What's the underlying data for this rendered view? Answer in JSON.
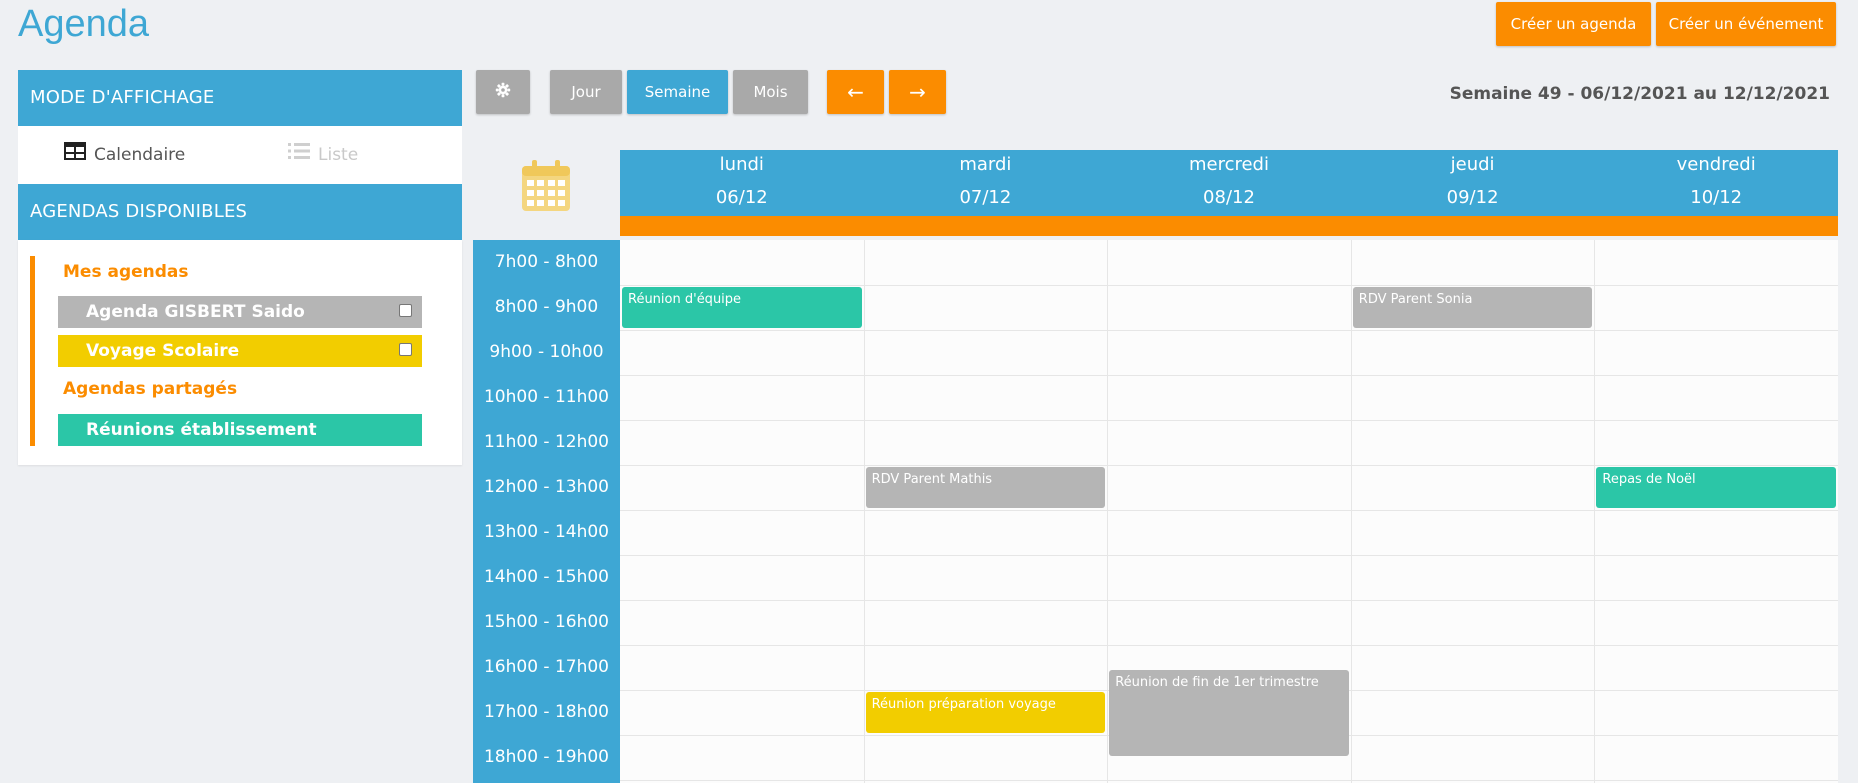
{
  "page": {
    "title": "Agenda"
  },
  "top_actions": {
    "create_agenda": "Créer un agenda",
    "create_event": "Créer un événement"
  },
  "sidebar": {
    "mode_title": "MODE D'AFFICHAGE",
    "mode_calendar": "Calendaire",
    "mode_list": "Liste",
    "agendas_title": "AGENDAS DISPONIBLES",
    "my_agendas_label": "Mes agendas",
    "shared_agendas_label": "Agendas partagés",
    "my_agendas": [
      {
        "label": "Agenda GISBERT Saido",
        "color": "#b5b5b5"
      },
      {
        "label": "Voyage Scolaire",
        "color": "#f2cd00"
      }
    ],
    "shared_agendas": [
      {
        "label": "Réunions établissement",
        "color": "#2bc6a7"
      }
    ]
  },
  "toolbar": {
    "settings_icon": "gear-icon",
    "day": "Jour",
    "week": "Semaine",
    "month": "Mois",
    "prev": "←",
    "next": "→",
    "active_view": "Semaine",
    "week_range": "Semaine 49 - 06/12/2021 au 12/12/2021"
  },
  "calendar": {
    "days": [
      {
        "name": "lundi",
        "date": "06/12"
      },
      {
        "name": "mardi",
        "date": "07/12"
      },
      {
        "name": "mercredi",
        "date": "08/12"
      },
      {
        "name": "jeudi",
        "date": "09/12"
      },
      {
        "name": "vendredi",
        "date": "10/12"
      }
    ],
    "hours": [
      "7h00 - 8h00",
      "8h00 - 9h00",
      "9h00 - 10h00",
      "10h00 - 11h00",
      "11h00 - 12h00",
      "12h00 - 13h00",
      "13h00 - 14h00",
      "14h00 - 15h00",
      "15h00 - 16h00",
      "16h00 - 17h00",
      "17h00 - 18h00",
      "18h00 - 19h00"
    ],
    "events": [
      {
        "title": "Réunion d'équipe",
        "day": 0,
        "start": 8.0,
        "end": 9.0,
        "color": "#2bc6a7"
      },
      {
        "title": "RDV Parent Sonia",
        "day": 3,
        "start": 8.0,
        "end": 9.0,
        "color": "#b5b5b5"
      },
      {
        "title": "RDV Parent Mathis",
        "day": 1,
        "start": 12.0,
        "end": 13.0,
        "color": "#b5b5b5"
      },
      {
        "title": "Repas de Noël",
        "day": 4,
        "start": 12.0,
        "end": 13.0,
        "color": "#2bc6a7"
      },
      {
        "title": "Réunion de fin de 1er trimestre",
        "day": 2,
        "start": 16.5,
        "end": 18.5,
        "color": "#b5b5b5"
      },
      {
        "title": "Réunion préparation voyage",
        "day": 1,
        "start": 17.0,
        "end": 18.0,
        "color": "#f2cd00"
      }
    ]
  },
  "colors": {
    "primary": "#3ea7d4",
    "accent": "#fb8c00",
    "inactive_button": "#a9a9a9",
    "calendar_icon": "#f4d680"
  }
}
